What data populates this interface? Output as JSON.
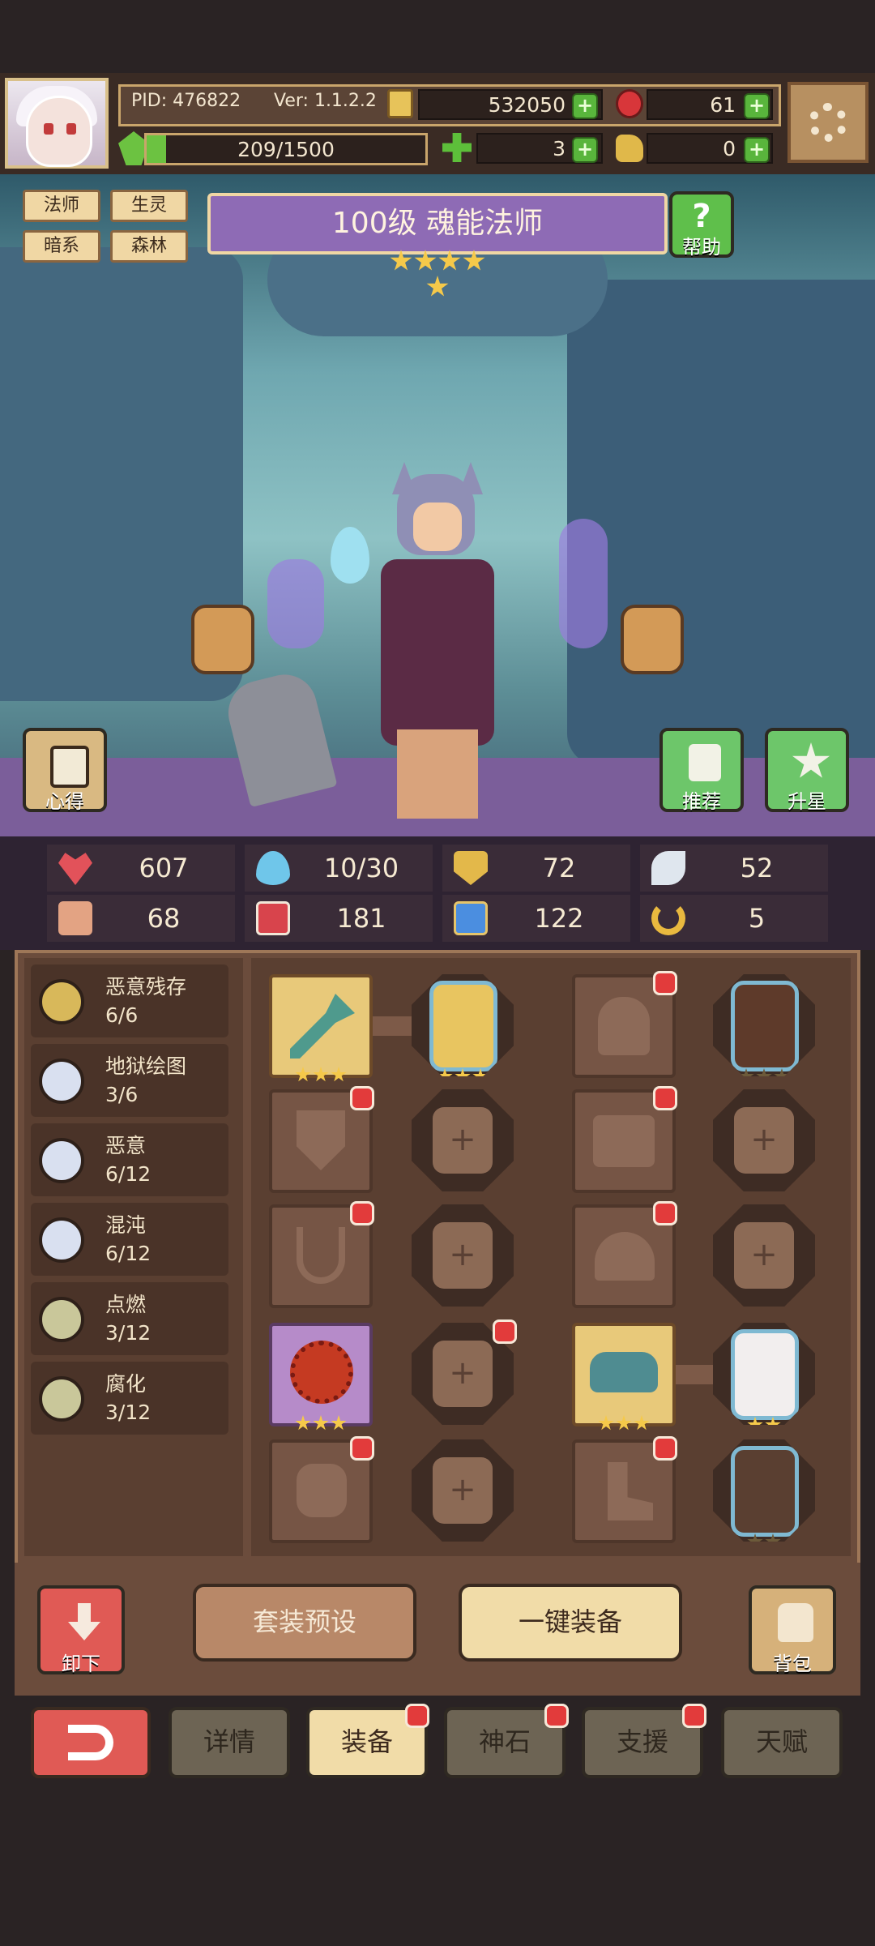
{
  "hud": {
    "pid": "PID: 476822",
    "version": "Ver: 1.1.2.2",
    "gold": "532050",
    "gems": "61",
    "energy": "209/1500",
    "clover": "3",
    "keys": "0"
  },
  "tags": [
    "法师",
    "生灵",
    "暗系",
    "森林"
  ],
  "hero": {
    "title": "100级 魂能法师",
    "stars": 5
  },
  "scene_buttons": {
    "help": "帮助",
    "insight": "心得",
    "recommend": "推荐",
    "star_up": "升星"
  },
  "stats": [
    {
      "icon": "heart-icon",
      "value": "607"
    },
    {
      "icon": "mana-drop-icon",
      "value": "10/30"
    },
    {
      "icon": "armor-icon",
      "value": "72"
    },
    {
      "icon": "wing-icon",
      "value": "52"
    },
    {
      "icon": "fist-icon",
      "value": "68"
    },
    {
      "icon": "spellbook-icon",
      "value": "181"
    },
    {
      "icon": "boots-icon",
      "value": "122"
    },
    {
      "icon": "horseshoe-icon",
      "value": "5"
    }
  ],
  "sets": [
    {
      "name": "恶意残存",
      "count": "6/6",
      "color": "#d8b85a"
    },
    {
      "name": "地狱绘图",
      "count": "3/6",
      "color": "#d9e0f0"
    },
    {
      "name": "恶意",
      "count": "6/12",
      "color": "#d9e0f0"
    },
    {
      "name": "混沌",
      "count": "6/12",
      "color": "#d9e0f0"
    },
    {
      "name": "点燃",
      "count": "3/12",
      "color": "#c9c79a"
    },
    {
      "name": "腐化",
      "count": "3/12",
      "color": "#c9c79a"
    }
  ],
  "actions": {
    "unequip": "卸下",
    "preset": "套装预设",
    "auto_equip": "一键装备",
    "bag": "背包"
  },
  "tabs": [
    "详情",
    "装备",
    "神石",
    "支援",
    "天赋"
  ],
  "colors": {
    "accent_red": "#e23b3b",
    "active_tab": "#f1dca8",
    "inactive_tab": "#6d6454"
  }
}
